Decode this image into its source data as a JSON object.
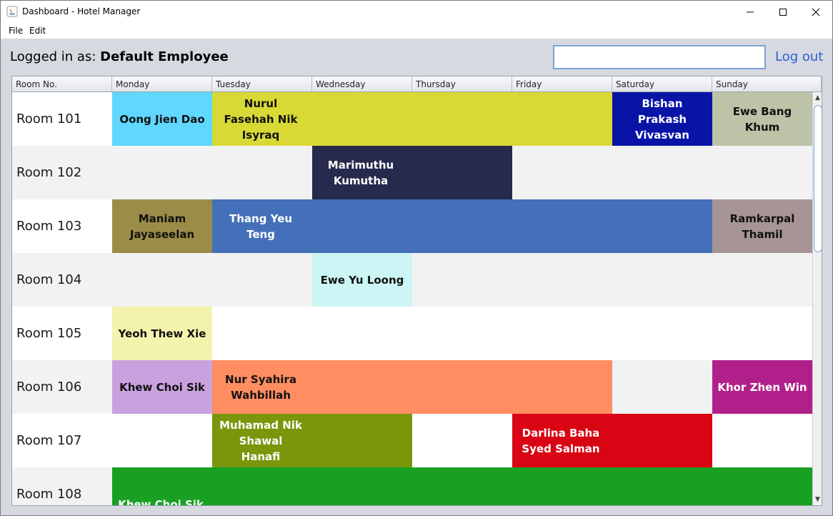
{
  "window": {
    "title": "Dashboard - Hotel Manager"
  },
  "menu": {
    "file": "File",
    "edit": "Edit"
  },
  "header": {
    "logged_prefix": "Logged in as: ",
    "employee_name": "Default Employee",
    "search_value": "",
    "logout_label": "Log out"
  },
  "columns": [
    "Room No.",
    "Monday",
    "Tuesday",
    "Wednesday",
    "Thursday",
    "Friday",
    "Saturday",
    "Sunday"
  ],
  "rows": [
    {
      "room": "Room 101",
      "bg": "#ffffff",
      "bookings": [
        {
          "name": "Oong Jien Dao",
          "start": 0,
          "span": 1,
          "color": "#5fd7ff",
          "text_color": "#111111"
        },
        {
          "name": "Nurul Fasehah Nik Isyraq",
          "start": 1,
          "span": 4,
          "color": "#d9d936",
          "text_color": "#111111"
        },
        {
          "name": "Bishan Prakash Vivasvan",
          "start": 5,
          "span": 1,
          "color": "#0914a6",
          "text_color": "#ffffff"
        },
        {
          "name": "Ewe Bang Khum",
          "start": 6,
          "span": 1,
          "color": "#bcc3a6",
          "text_color": "#111111"
        }
      ]
    },
    {
      "room": "Room 102",
      "bg": "#f2f2f2",
      "bookings": [
        {
          "name": "Marimuthu Kumutha",
          "start": 2,
          "span": 2,
          "color": "#262a4c",
          "text_color": "#ffffff"
        }
      ]
    },
    {
      "room": "Room 103",
      "bg": "#ffffff",
      "bookings": [
        {
          "name": "Maniam Jayaseelan",
          "start": 0,
          "span": 1,
          "color": "#9b8c47",
          "text_color": "#111111"
        },
        {
          "name": "Thang Yeu Teng",
          "start": 1,
          "span": 5,
          "color": "#4370b8",
          "text_color": "#ffffff"
        },
        {
          "name": "Ramkarpal Thamil",
          "start": 6,
          "span": 1,
          "color": "#a79495",
          "text_color": "#111111"
        }
      ]
    },
    {
      "room": "Room 104",
      "bg": "#f2f2f2",
      "bookings": [
        {
          "name": "Ewe Yu Loong",
          "start": 2,
          "span": 1,
          "color": "#ccf5f5",
          "text_color": "#111111"
        }
      ]
    },
    {
      "room": "Room 105",
      "bg": "#ffffff",
      "bookings": [
        {
          "name": "Yeoh Thew Xie",
          "start": 0,
          "span": 1,
          "color": "#f3f3ad",
          "text_color": "#111111"
        }
      ]
    },
    {
      "room": "Room 106",
      "bg": "#f2f2f2",
      "bookings": [
        {
          "name": "Khew Choi Sik",
          "start": 0,
          "span": 1,
          "color": "#c9a1df",
          "text_color": "#111111"
        },
        {
          "name": "Nur Syahira Wahbillah",
          "start": 1,
          "span": 4,
          "color": "#ff8d62",
          "text_color": "#111111"
        },
        {
          "name": "Khor Zhen Win",
          "start": 6,
          "span": 1,
          "color": "#b1208a",
          "text_color": "#ffffff"
        }
      ]
    },
    {
      "room": "Room 107",
      "bg": "#ffffff",
      "bookings": [
        {
          "name": "Muhamad Nik Shawal Hanafi",
          "start": 1,
          "span": 2,
          "color": "#7a960a",
          "text_color": "#ffffff"
        },
        {
          "name": "Darlina Baha Syed Salman",
          "start": 4,
          "span": 2,
          "color": "#d90514",
          "text_color": "#ffffff"
        }
      ]
    },
    {
      "room": "Room 108",
      "bg": "#f2f2f2",
      "bookings": [
        {
          "name": "Khew Choi Sik",
          "start": 0,
          "span": 7,
          "color": "#19a023",
          "text_color": "#ffffff"
        }
      ]
    }
  ]
}
